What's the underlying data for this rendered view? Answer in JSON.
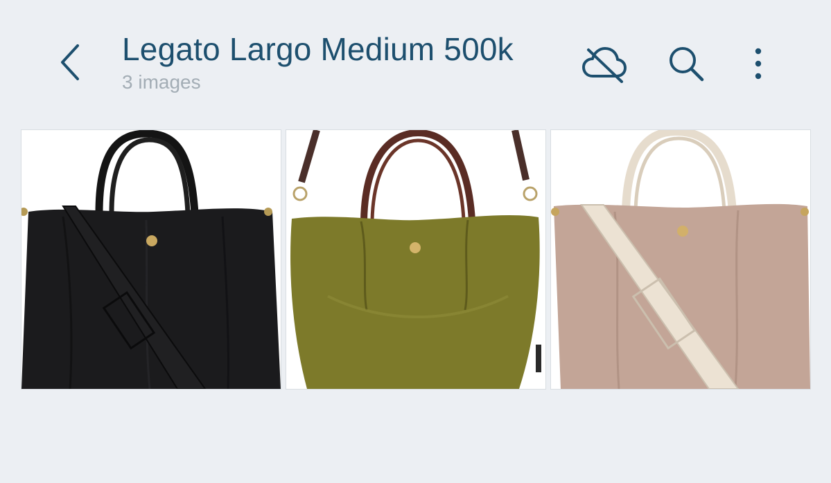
{
  "header": {
    "title": "Legato Largo Medium 500k",
    "subtitle": "3 images"
  },
  "icons": {
    "back": "chevron-left-icon",
    "cloud_off": "cloud-off-icon",
    "search": "search-icon",
    "more": "more-vertical-icon"
  },
  "colors": {
    "background": "#eceff3",
    "title": "#1d4f6e",
    "subtitle": "#a3adb5",
    "icon": "#1d4f6e"
  },
  "gallery": {
    "images": [
      {
        "name": "black-bag-image",
        "bag_color": "#1b1b1d",
        "handle_color": "#141414",
        "strap_color": "#202022"
      },
      {
        "name": "olive-bag-image",
        "bag_color": "#7d7a2a",
        "handle_color": "#5a2c24",
        "strap_color": "#4a2f2a"
      },
      {
        "name": "taupe-bag-image",
        "bag_color": "#c3a597",
        "handle_color": "#e6dccd",
        "strap_color": "#ece2d3"
      }
    ]
  }
}
